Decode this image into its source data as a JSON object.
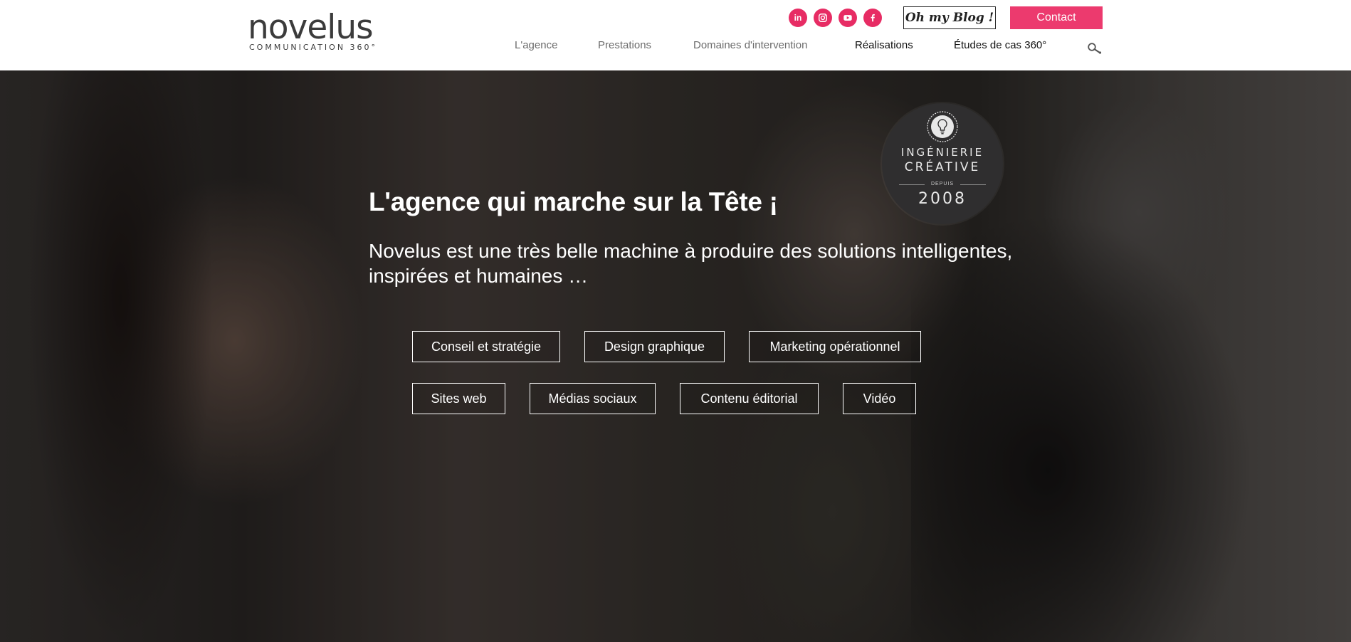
{
  "logo": {
    "wordmark": "novelus",
    "tagline": "COMMUNICATION 360°"
  },
  "socials": [
    {
      "icon": "linkedin-icon",
      "glyph": "in"
    },
    {
      "icon": "instagram-icon"
    },
    {
      "icon": "youtube-icon"
    },
    {
      "icon": "facebook-icon"
    }
  ],
  "header": {
    "blog_label": "Oh my Blog !",
    "contact_label": "Contact"
  },
  "nav": [
    {
      "label": "L'agence"
    },
    {
      "label": "Prestations"
    },
    {
      "label": "Domaines d'intervention"
    },
    {
      "label": "Réalisations"
    },
    {
      "label": "Études de cas 360°"
    }
  ],
  "hero": {
    "title": "L'agence qui marche sur la Tête ¡",
    "subtitle": "Novelus est une très belle machine à produire des solutions intelligentes, inspirées et humaines …"
  },
  "badge": {
    "line1": "INGÉNIERIE",
    "line2": "CRÉATIVE",
    "small": "DEPUIS",
    "year": "2008"
  },
  "services": [
    {
      "label": "Conseil et stratégie"
    },
    {
      "label": "Design graphique"
    },
    {
      "label": "Marketing opérationnel"
    },
    {
      "label": "Sites web"
    },
    {
      "label": "Médias sociaux"
    },
    {
      "label": "Contenu éditorial"
    },
    {
      "label": "Vidéo"
    }
  ],
  "colors": {
    "accent": "#ec3a6e",
    "social": "#e72c64",
    "text_dark": "#111111",
    "text_muted": "#6c6c6c"
  }
}
